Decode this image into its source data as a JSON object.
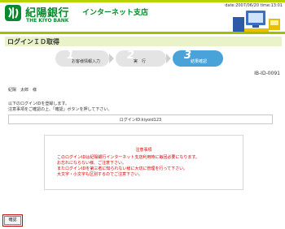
{
  "header": {
    "bank_name": "紀陽銀行",
    "branch_name": "インターネット支店",
    "bank_name_en": "THE KIYO BANK",
    "datetime": "date:2007/06/20 time:13:01"
  },
  "page": {
    "title": "ログインＩＤ取得",
    "reference_code": "IB-ID-0091"
  },
  "steps": [
    {
      "num": "1",
      "label": "お客様情報入力",
      "active": false
    },
    {
      "num": "2",
      "label": "実　行",
      "active": false
    },
    {
      "num": "3",
      "label": "結果確認",
      "active": true
    }
  ],
  "customer_name": "紀陽　太郎　様",
  "messages": {
    "line1": "以下のログインIDを登録します。",
    "line2": "注意事項をご確認の上、「確認」ボタンを押して下さい。"
  },
  "login_id": "ログインID:kiyoid123",
  "notice": {
    "title": "注意事項",
    "lines": [
      "このログインIDは紀陽銀行インターネット支店利用時に毎回必要になります。",
      "お忘れにならない様、ご注意下さい。",
      "またログインIDを第三者に知られない様に大切に管理を行って下さい。",
      "大文字・小文字も区別するのでご注意下さい。"
    ]
  },
  "buttons": {
    "confirm": "確認"
  },
  "colors": {
    "brand_green": "#0a8a2e",
    "accent_lime": "#b8d400",
    "active_step": "#4aa3d8",
    "notice_red": "#cc0000"
  }
}
